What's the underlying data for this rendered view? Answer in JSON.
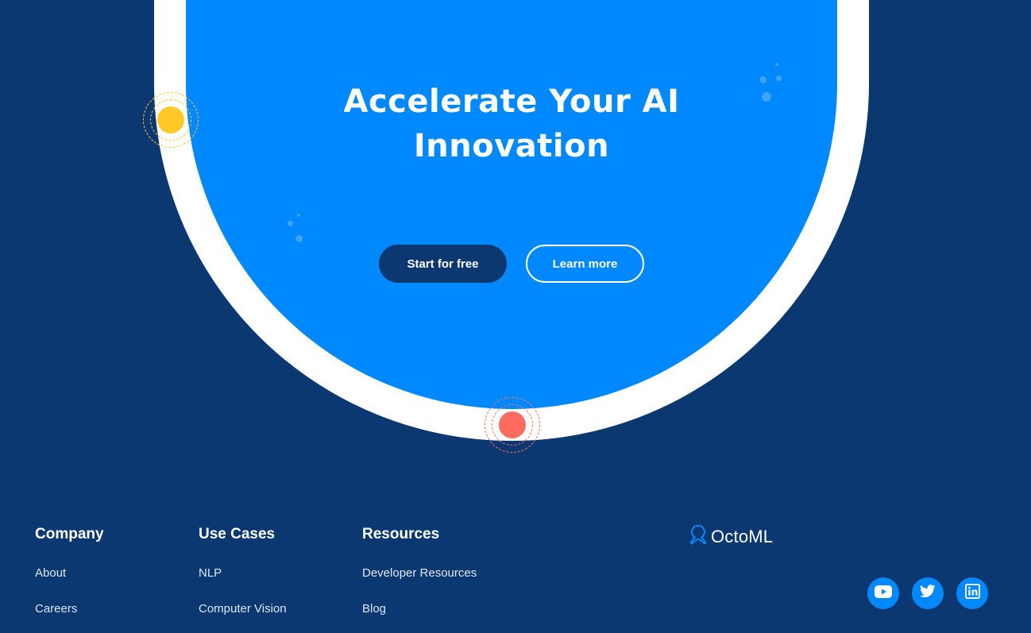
{
  "hero": {
    "title_line1": "Accelerate Your AI",
    "title_line2": "Innovation",
    "primary_button": "Start for free",
    "secondary_button": "Learn more"
  },
  "colors": {
    "background": "#0b3870",
    "accent": "#0088ff",
    "yellow": "#ffc928",
    "coral": "#ff6b5e",
    "white": "#ffffff"
  },
  "footer": {
    "columns": [
      {
        "heading": "Company",
        "links": [
          "About",
          "Careers"
        ]
      },
      {
        "heading": "Use Cases",
        "links": [
          "NLP",
          "Computer Vision"
        ]
      },
      {
        "heading": "Resources",
        "links": [
          "Developer Resources",
          "Blog"
        ]
      }
    ],
    "logo_text": "OctoML",
    "social": [
      {
        "icon": "youtube-icon"
      },
      {
        "icon": "twitter-icon"
      },
      {
        "icon": "linkedin-icon"
      }
    ]
  }
}
